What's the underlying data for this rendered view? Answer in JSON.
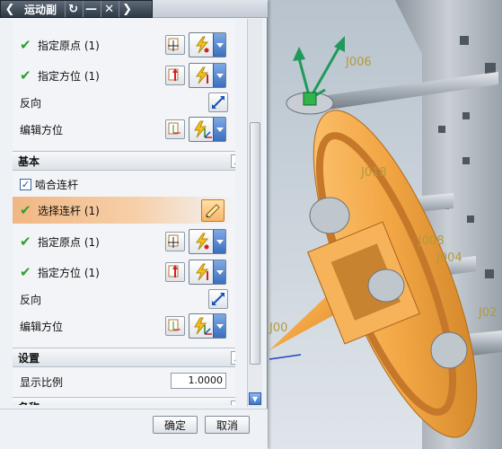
{
  "dialog": {
    "title": "运动副",
    "title_buttons": [
      "back-icon",
      "refresh-icon",
      "minimize-icon",
      "close-icon",
      "more-icon"
    ]
  },
  "top_group": {
    "rows": [
      {
        "label": "指定原点 (1)",
        "complete": true
      },
      {
        "label": "指定方位 (1)",
        "complete": true
      }
    ],
    "reverse_label": "反向",
    "edit_orientation_label": "编辑方位"
  },
  "basic_section": {
    "title": "基本",
    "engage_link_label": "啮合连杆",
    "engage_link_checked": true,
    "select_link_label": "选择连杆 (1)",
    "rows": [
      {
        "label": "指定原点 (1)",
        "complete": true
      },
      {
        "label": "指定方位 (1)",
        "complete": true
      }
    ],
    "reverse_label": "反向",
    "edit_orientation_label": "编辑方位"
  },
  "settings_section": {
    "title": "设置",
    "display_scale_label": "显示比例",
    "display_scale_value": "1.0000"
  },
  "name_section": {
    "title": "名称"
  },
  "footer": {
    "ok_label": "确定",
    "cancel_label": "取消"
  },
  "viewport": {
    "labels": [
      "J006",
      "J018",
      "J008",
      "J004",
      "J02",
      "J00"
    ]
  },
  "colors": {
    "accent_orange": "#f0a85c",
    "check_green": "#2aa12a",
    "part_orange": "#f2a644",
    "label_gold": "#b39a3c"
  }
}
